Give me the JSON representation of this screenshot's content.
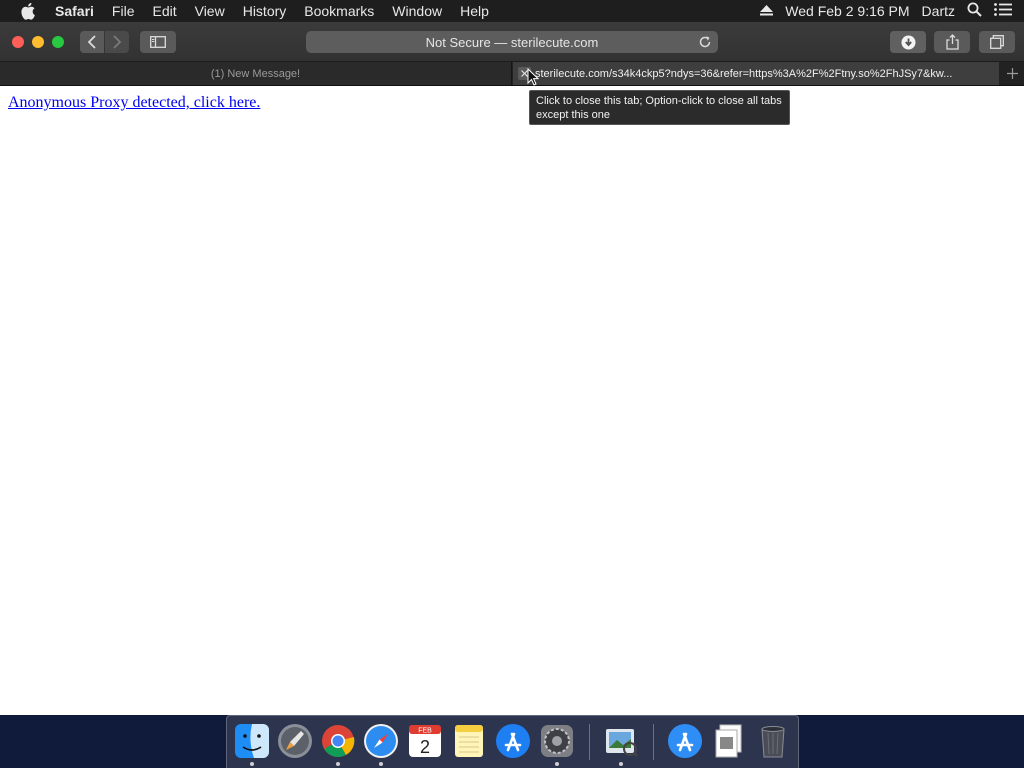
{
  "menubar": {
    "app_name": "Safari",
    "menus": [
      "File",
      "Edit",
      "View",
      "History",
      "Bookmarks",
      "Window",
      "Help"
    ],
    "clock": "Wed Feb 2  9:16 PM",
    "user": "Dartz"
  },
  "toolbar": {
    "address_text": "Not Secure — sterilecute.com"
  },
  "tabs": [
    {
      "title": "(1) New Message!",
      "active": false
    },
    {
      "title": "sterilecute.com/s34k4ckp5?ndys=36&refer=https%3A%2F%2Ftny.so%2FhJSy7&kw...",
      "active": true
    }
  ],
  "tooltip": {
    "text": "Click to close this tab; Option-click to close all tabs except this one"
  },
  "page": {
    "link_text": "Anonymous Proxy detected, click here."
  },
  "dock": {
    "calendar_month": "FEB",
    "calendar_day": "2",
    "icons": [
      "finder-icon",
      "launchpad-icon",
      "chrome-icon",
      "safari-icon",
      "calendar-icon",
      "notes-icon",
      "app-store-icon",
      "system-preferences-icon",
      "preview-icon",
      "app-store-downloads-icon",
      "documents-icon",
      "trash-icon"
    ]
  },
  "colors": {
    "link": "#0000ee",
    "close": "#fe5f57",
    "minimize": "#febc2e",
    "maximize": "#28c840"
  }
}
